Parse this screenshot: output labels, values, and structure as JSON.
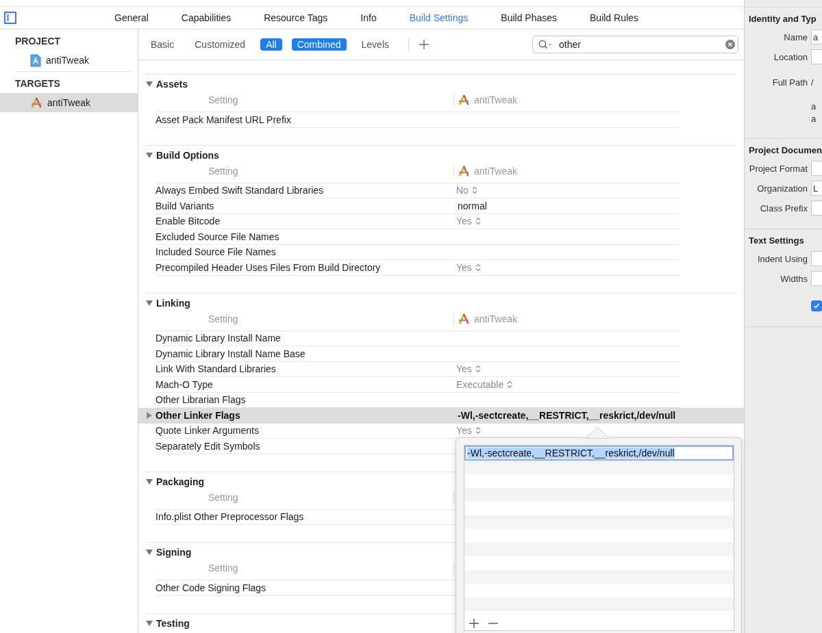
{
  "tabs": [
    {
      "label": "General",
      "selected": false
    },
    {
      "label": "Capabilities",
      "selected": false
    },
    {
      "label": "Resource Tags",
      "selected": false
    },
    {
      "label": "Info",
      "selected": false
    },
    {
      "label": "Build Settings",
      "selected": true
    },
    {
      "label": "Build Phases",
      "selected": false
    },
    {
      "label": "Build Rules",
      "selected": false
    }
  ],
  "sidebar": {
    "groups": [
      {
        "title": "PROJECT",
        "items": [
          {
            "label": "antiTweak",
            "kind": "project",
            "selected": false
          }
        ]
      },
      {
        "title": "TARGETS",
        "items": [
          {
            "label": "antiTweak",
            "kind": "target",
            "selected": true
          }
        ]
      }
    ]
  },
  "filter_bar": {
    "filters": [
      {
        "label": "Basic",
        "selected": false
      },
      {
        "label": "Customized",
        "selected": false
      },
      {
        "label": "All",
        "selected": true
      }
    ],
    "views": [
      {
        "label": "Combined",
        "selected": true
      },
      {
        "label": "Levels",
        "selected": false
      }
    ],
    "search": {
      "value": "other"
    }
  },
  "sections": [
    {
      "title": "Assets",
      "expanded": true,
      "columns": [
        "Setting",
        "antiTweak"
      ],
      "rows": [
        {
          "name": "Asset Pack Manifest URL Prefix",
          "kind": "plain",
          "selected": false
        }
      ]
    },
    {
      "title": "Build Options",
      "expanded": true,
      "columns": [
        "Setting",
        "antiTweak"
      ],
      "rows": [
        {
          "name": "Always Embed Swift Standard Libraries",
          "kind": "popup",
          "value": "No",
          "selected": false
        },
        {
          "name": "Build Variants",
          "kind": "text",
          "value": "normal",
          "selected": false
        },
        {
          "name": "Enable Bitcode",
          "kind": "popup",
          "value": "Yes",
          "selected": false
        },
        {
          "name": "Excluded Source File Names",
          "kind": "plain",
          "selected": false
        },
        {
          "name": "Included Source File Names",
          "kind": "plain",
          "selected": false
        },
        {
          "name": "Precompiled Header Uses Files From Build Directory",
          "kind": "popup",
          "value": "Yes",
          "selected": false
        }
      ]
    },
    {
      "title": "Linking",
      "expanded": true,
      "columns": [
        "Setting",
        "antiTweak"
      ],
      "rows": [
        {
          "name": "Dynamic Library Install Name",
          "kind": "plain",
          "selected": false
        },
        {
          "name": "Dynamic Library Install Name Base",
          "kind": "plain",
          "selected": false
        },
        {
          "name": "Link With Standard Libraries",
          "kind": "popup",
          "value": "Yes",
          "selected": false
        },
        {
          "name": "Mach-O Type",
          "kind": "popup",
          "value": "Executable",
          "selected": false
        },
        {
          "name": "Other Librarian Flags",
          "kind": "plain",
          "selected": false
        },
        {
          "name": "Other Linker Flags",
          "kind": "list",
          "value": "-Wl,-sectcreate,__RESTRICT,__reskrict,/dev/null",
          "expanded": false,
          "selected": true
        },
        {
          "name": "Quote Linker Arguments",
          "kind": "popup",
          "value": "Yes",
          "selected": false
        },
        {
          "name": "Separately Edit Symbols",
          "kind": "plain",
          "selected": false
        }
      ]
    },
    {
      "title": "Packaging",
      "expanded": true,
      "columns": [
        "Setting"
      ],
      "rows": [
        {
          "name": "Info.plist Other Preprocessor Flags",
          "kind": "plain",
          "selected": false
        }
      ]
    },
    {
      "title": "Signing",
      "expanded": true,
      "columns": [
        "Setting"
      ],
      "rows": [
        {
          "name": "Other Code Signing Flags",
          "kind": "plain",
          "selected": false
        }
      ]
    },
    {
      "title": "Testing",
      "expanded": true
    }
  ],
  "popover": {
    "value": "-Wl,-sectcreate,__RESTRICT,__reskrict,/dev/null",
    "value_selected": true
  },
  "inspector": {
    "sections": [
      {
        "title": "Identity and Typ",
        "fields": [
          {
            "kind": "field",
            "label": "Name",
            "value": "a"
          },
          {
            "kind": "field",
            "label": "Location"
          },
          {
            "kind": "path",
            "label": "Full Path",
            "lines": [
              "/",
              "a",
              "a"
            ]
          }
        ]
      },
      {
        "title": "Project Documen",
        "fields": [
          {
            "kind": "field",
            "label": "Project Format"
          },
          {
            "kind": "field",
            "label": "Organization",
            "value": "L"
          },
          {
            "kind": "field",
            "label": "Class Prefix"
          }
        ]
      },
      {
        "title": "Text Settings",
        "fields": [
          {
            "kind": "field",
            "label": "Indent Using"
          },
          {
            "kind": "field",
            "label": "Widths"
          },
          {
            "kind": "checkbox",
            "checked": true
          }
        ]
      }
    ]
  }
}
